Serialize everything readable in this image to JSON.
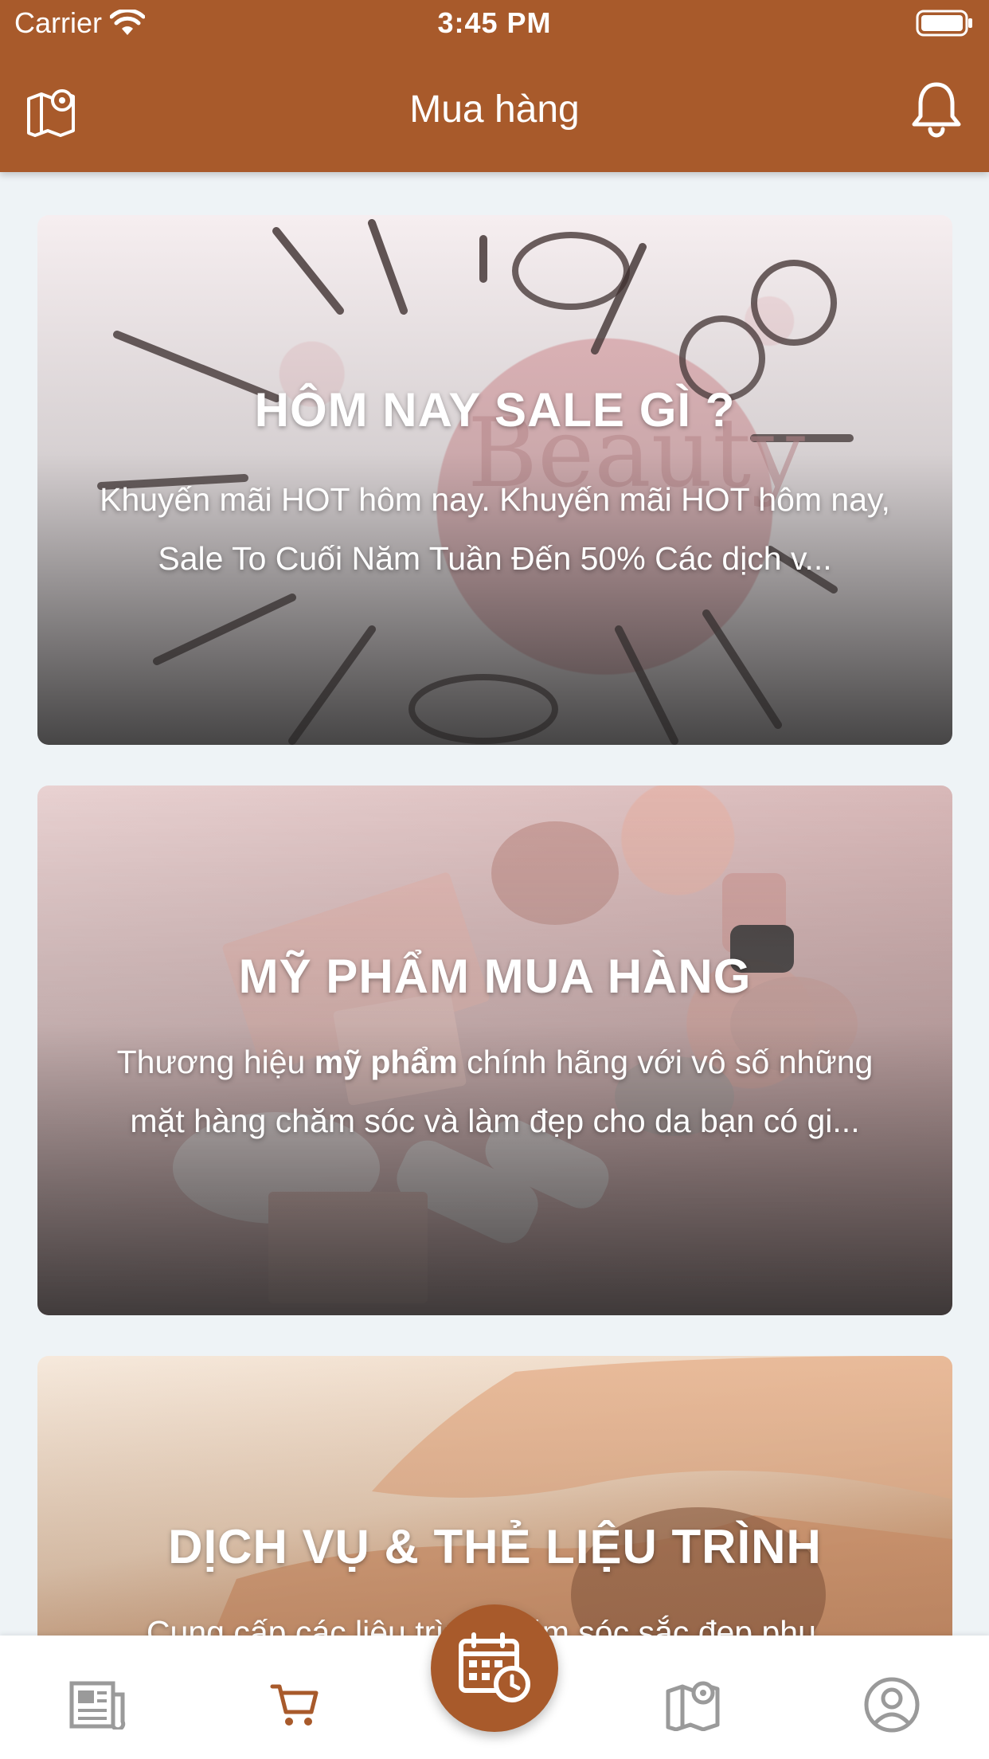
{
  "status_bar": {
    "carrier": "Carrier",
    "time": "3:45 PM"
  },
  "header": {
    "title": "Mua hàng",
    "left_icon": "map-pin-icon",
    "right_icon": "bell-icon",
    "color": "#a85a2b"
  },
  "cards": [
    {
      "title": "HÔM NAY SALE GÌ ?",
      "description": "Khuyến mãi HOT hôm nay. Khuyến mãi HOT hôm nay, Sale To Cuối Năm Tuần Đến 50% Các dịch v..."
    },
    {
      "title": "MỸ PHẨM MUA HÀNG",
      "description_prefix": "Thương hiệu ",
      "description_bold": "mỹ phẩm",
      "description_suffix": " chính hãng với vô số những mặt hàng chăm sóc và làm đẹp cho da bạn có gi..."
    },
    {
      "title": "DỊCH VỤ & THẺ LIỆU TRÌNH",
      "description": "Cung cấp các liệu trình chăm sóc sắc đẹp phụ..."
    }
  ],
  "tab_bar": {
    "tabs": [
      "news-icon",
      "cart-icon",
      "calendar-clock-icon",
      "map-icon",
      "profile-icon"
    ],
    "active": "cart-icon",
    "active_color": "#a85a2b",
    "inactive_color": "#9a9a9a"
  }
}
